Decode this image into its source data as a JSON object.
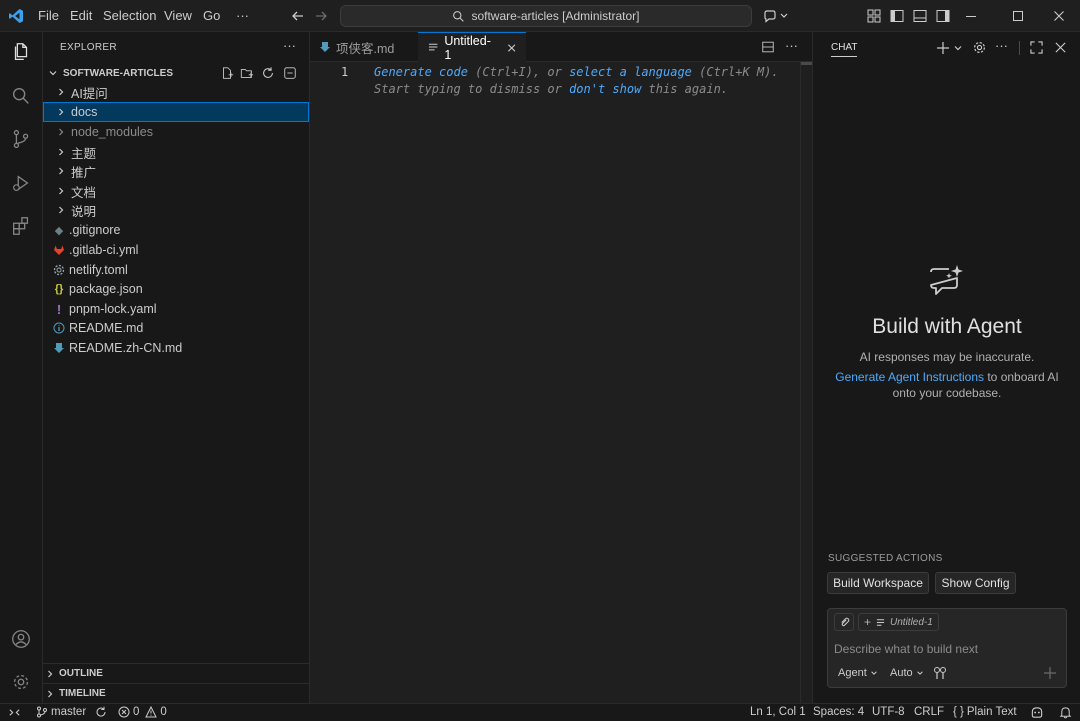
{
  "titlebar": {
    "menus": [
      "File",
      "Edit",
      "Selection",
      "View",
      "Go",
      "···"
    ],
    "search_text": "software-articles [Administrator]"
  },
  "explorer": {
    "title": "EXPLORER",
    "root": "SOFTWARE-ARTICLES",
    "folders": [
      "AI提问",
      "docs",
      "node_modules",
      "主题",
      "推广",
      "文档",
      "说明"
    ],
    "files": [
      ".gitignore",
      ".gitlab-ci.yml",
      "netlify.toml",
      "package.json",
      "pnpm-lock.yaml",
      "README.md",
      "README.zh-CN.md"
    ],
    "outline": "OUTLINE",
    "timeline": "TIMELINE"
  },
  "editor": {
    "tabs": [
      "项侠客.md",
      "Untitled-1"
    ],
    "line_number": "1",
    "hint_line1": {
      "a": "Generate code",
      "b": " (Ctrl+I), or ",
      "c": "select a language",
      "d": " (Ctrl+K M)."
    },
    "hint_line2": {
      "a": "Start typing to dismiss or ",
      "b": "don't show",
      "c": " this again."
    }
  },
  "chat": {
    "title": "CHAT",
    "heading": "Build with Agent",
    "disclaimer": "AI responses may be inaccurate.",
    "link": "Generate Agent Instructions",
    "onboard_1": " to onboard AI",
    "onboard_2": "onto your codebase.",
    "suggested_title": "SUGGESTED ACTIONS",
    "actions": [
      "Build Workspace",
      "Show Config"
    ],
    "context_file": "Untitled-1",
    "placeholder": "Describe what to build next",
    "mode": "Agent",
    "model": "Auto"
  },
  "status": {
    "branch": "master",
    "errors": "0",
    "warnings": "0",
    "position": "Ln 1, Col 1",
    "spaces": "Spaces: 4",
    "encoding": "UTF-8",
    "eol": "CRLF",
    "language": "Plain Text"
  },
  "colors": {
    "accent": "#0078d4",
    "link": "#4daafc",
    "selection": "#04395e"
  }
}
